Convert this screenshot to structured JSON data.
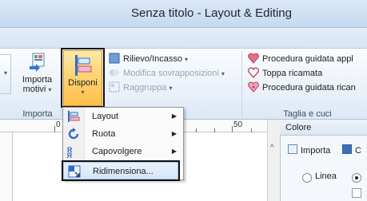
{
  "window": {
    "title": "Senza titolo - Layout & Editing"
  },
  "colors": {
    "ribbon_accent": "#ffc04a",
    "highlight_border": "#111111",
    "menu_selected": "#d6e6f8"
  },
  "ribbon": {
    "import_button": {
      "label_line1": "Importa",
      "label_line2": "motivi",
      "icon": "import-icon"
    },
    "arrange_button": {
      "label": "Disponi",
      "icon": "layout-arrange-icon"
    },
    "group_labels": {
      "import": "Importa",
      "patches": "Taglia e cuci"
    },
    "small_buttons": {
      "relief": "Rilievo/Incasso",
      "modify_overlaps": "Modifica sovrapposizioni",
      "group": "Raggruppa"
    },
    "patch_buttons": {
      "wizard1": "Procedura guidata appl",
      "patch": "Toppa ricamata",
      "wizard2": "Procedura guidata rican"
    }
  },
  "ruler": {
    "mark_0": "0",
    "mark_50": "50"
  },
  "panel": {
    "title": "Colore",
    "import_tab": "Importa",
    "second_tab": "C",
    "radio_line": "Linea"
  },
  "menu": {
    "items": [
      {
        "label": "Layout",
        "icon": "layout-icon",
        "submenu": true
      },
      {
        "label": "Ruota",
        "icon": "rotate-icon",
        "submenu": true
      },
      {
        "label": "Capovolgere",
        "icon": "flip-icon",
        "submenu": true
      },
      {
        "label": "Ridimensiona...",
        "icon": "resize-icon",
        "submenu": false
      }
    ]
  }
}
